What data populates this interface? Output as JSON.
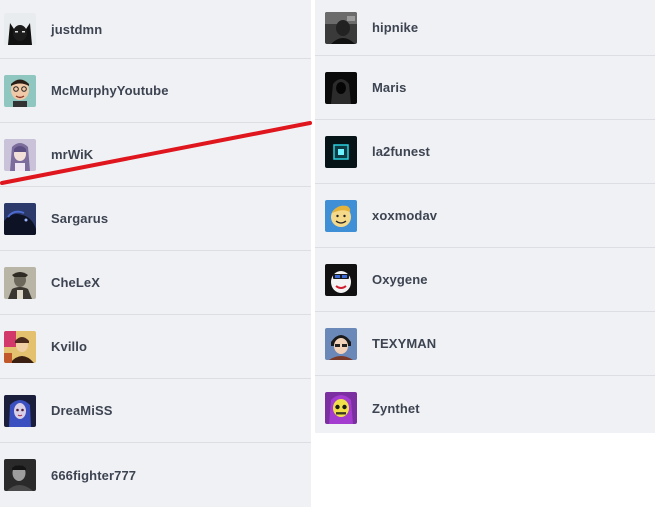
{
  "left_column": {
    "items": [
      {
        "name": "justdmn",
        "avatar": "batman-avatar"
      },
      {
        "name": "McMurphyYoutube",
        "avatar": "cartoon-face-avatar"
      },
      {
        "name": "mrWiK",
        "avatar": "anime-girl-avatar"
      },
      {
        "name": "Sargarus",
        "avatar": "dark-creature-avatar"
      },
      {
        "name": "CheLeX",
        "avatar": "vintage-photo-avatar"
      },
      {
        "name": "Kvillo",
        "avatar": "colorful-art-avatar"
      },
      {
        "name": "DreaMiSS",
        "avatar": "blue-hair-girl-avatar"
      },
      {
        "name": "666fighter777",
        "avatar": "bw-portrait-avatar"
      }
    ]
  },
  "right_column": {
    "items": [
      {
        "name": "hipnike",
        "avatar": "dark-figure-avatar"
      },
      {
        "name": "Maris",
        "avatar": "hooded-figure-avatar"
      },
      {
        "name": "la2funest",
        "avatar": "glowing-cube-avatar"
      },
      {
        "name": "xoxmodav",
        "avatar": "vault-boy-avatar"
      },
      {
        "name": "Oxygene",
        "avatar": "cartoon-mascot-avatar"
      },
      {
        "name": "TEXYMAN",
        "avatar": "anime-boy-avatar"
      },
      {
        "name": "Zynthet",
        "avatar": "skeletor-avatar"
      }
    ]
  },
  "colors": {
    "panel_bg": "#f0f1f5",
    "row_divider": "#dcdee3",
    "name_text": "#3d4451",
    "strike_line": "#e0161e"
  }
}
